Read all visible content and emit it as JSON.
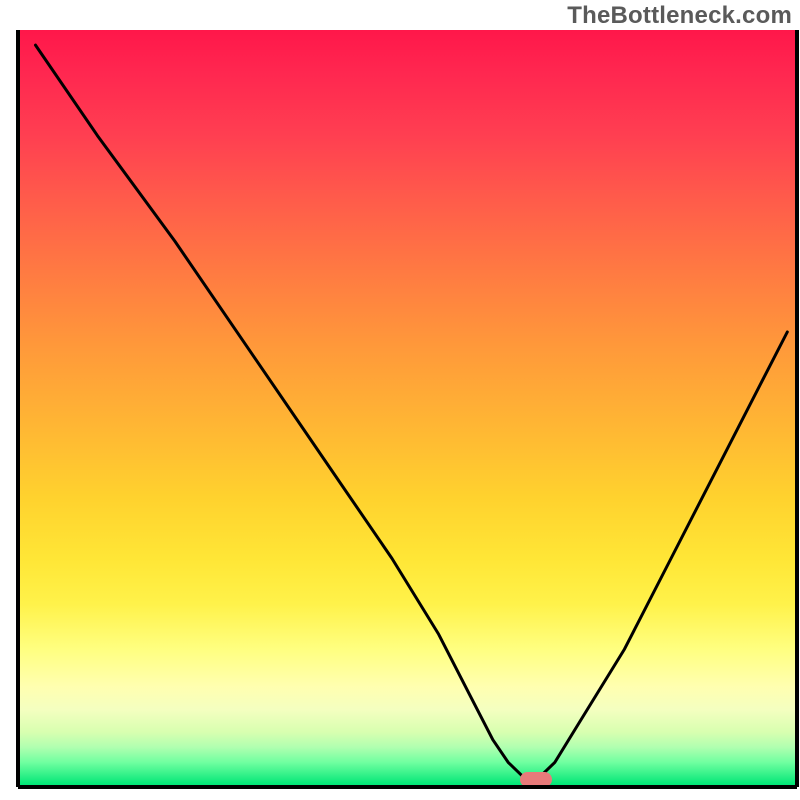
{
  "watermark": "TheBottleneck.com",
  "chart_data": {
    "type": "line",
    "title": "",
    "xlabel": "",
    "ylabel": "",
    "xlim": [
      0,
      100
    ],
    "ylim": [
      0,
      100
    ],
    "series": [
      {
        "name": "bottleneck-curve",
        "x": [
          2,
          10,
          20,
          26,
          30,
          36,
          42,
          48,
          54,
          58,
          61,
          63,
          65,
          67,
          69,
          72,
          78,
          84,
          90,
          96,
          99
        ],
        "values": [
          98,
          86,
          72,
          63,
          57,
          48,
          39,
          30,
          20,
          12,
          6,
          3,
          1,
          1,
          3,
          8,
          18,
          30,
          42,
          54,
          60
        ]
      }
    ],
    "marker": {
      "x": 66,
      "y": 0.8,
      "width": 3,
      "height": 1.5,
      "color": "#e87a7a"
    },
    "gradient_bands": [
      {
        "y_from": 100,
        "y_to": 30,
        "colors": [
          "#ff1744",
          "#ff5252",
          "#ff8a50",
          "#ffb140",
          "#ffd740"
        ]
      },
      {
        "y_from": 30,
        "y_to": 10,
        "colors": [
          "#ffe84a",
          "#fff176",
          "#ffff8d"
        ]
      },
      {
        "y_from": 10,
        "y_to": 4,
        "colors": [
          "#ffffb3",
          "#f0ffb0",
          "#d8ffa8"
        ]
      },
      {
        "y_from": 4,
        "y_to": 0,
        "colors": [
          "#a0ffb0",
          "#50ff90",
          "#00e676"
        ]
      }
    ],
    "border": {
      "visible_sides": [
        "top",
        "right",
        "bottom",
        "left"
      ],
      "color": "#000000",
      "width": 4
    }
  }
}
